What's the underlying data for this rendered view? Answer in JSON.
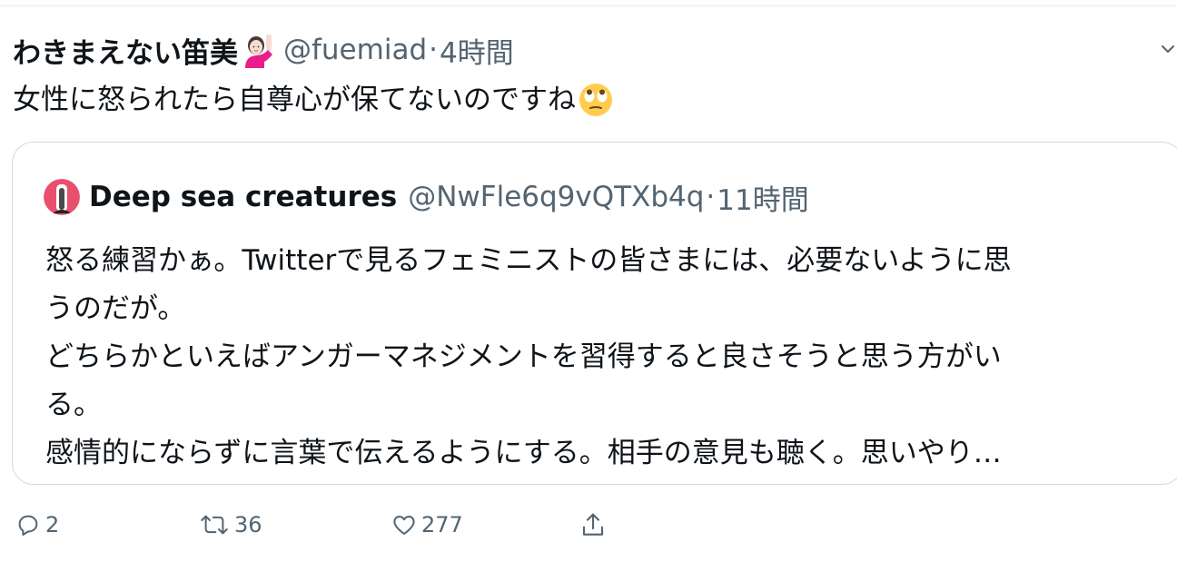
{
  "tweet": {
    "display_name": "わきまえない笛美",
    "handle": "@fuemiad",
    "separator": "·",
    "time": "4時間",
    "text": "女性に怒られたら自尊心が保てないのですね",
    "name_emoji": "woman-raising-hand-emoji",
    "text_emoji": "face-with-rolling-eyes-emoji"
  },
  "quote": {
    "display_name": "Deep sea creatures",
    "handle": "@NwFle6q9vQTXb4q",
    "separator": "·",
    "time": "11時間",
    "lines": [
      "怒る練習かぁ。Twitterで見るフェミニストの皆さまには、必要ないように思",
      "うのだが。",
      "どちらかといえばアンガーマネジメントを習得すると良さそうと思う方がい",
      "る。",
      "感情的にならずに言葉で伝えるようにする。相手の意見も聴く。思いやり…"
    ]
  },
  "actions": {
    "reply_count": "2",
    "retweet_count": "36",
    "like_count": "277"
  },
  "colors": {
    "text": "#0f1419",
    "secondary": "#536471",
    "border": "#cfd9de"
  }
}
